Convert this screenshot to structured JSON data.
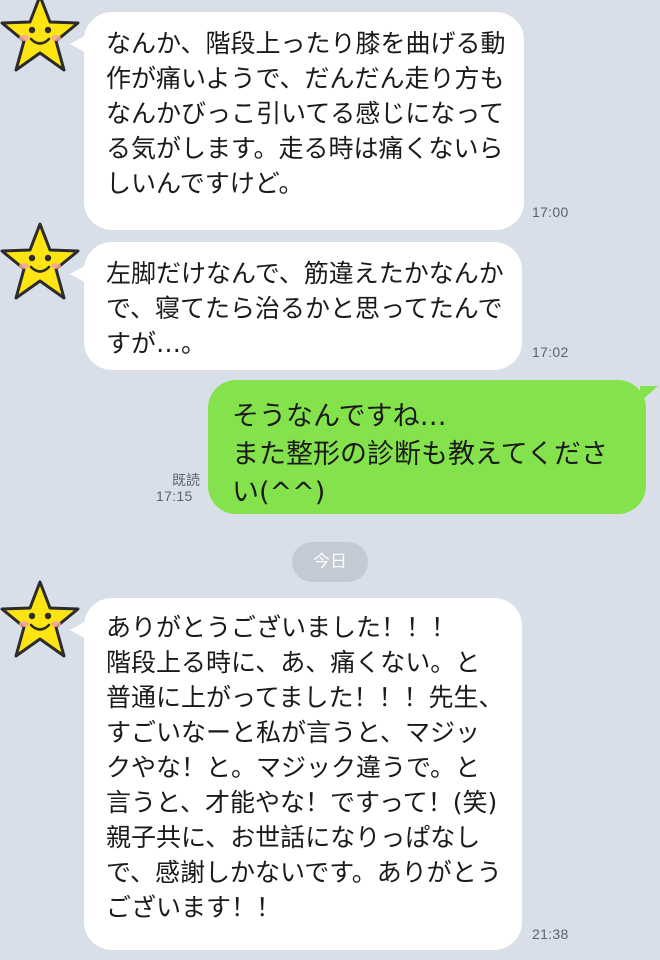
{
  "messages": [
    {
      "text": "なんか、階段上ったり膝を曲げる動作が痛いようで、だんだん走り方もなんかびっこ引いてる感じになってる気がします。走る時は痛くないらしいんですけど。",
      "time": "17:00",
      "avatar": "smiling-star-avatar"
    },
    {
      "text": "左脚だけなんで、筋違えたかなんかで、寝てたら治るかと思ってたんですが…。",
      "time": "17:02",
      "avatar": "smiling-star-avatar"
    },
    {
      "text": "そうなんですね…\nまた整形の診断も教えてください(^^)",
      "time": "17:15",
      "read_label": "既読"
    },
    {
      "text": "ありがとうございました！！！\n階段上る時に、あ、痛くない。と普通に上がってました！！！先生、すごいなーと私が言うと、マジックやな！と。マジック違うで。と言うと、才能やな！ですって！(笑)\n親子共に、お世話になりっぱなしで、感謝しかないです。ありがとうございます！！",
      "time": "21:38",
      "avatar": "smiling-star-avatar"
    }
  ],
  "date_separator": "今日",
  "colors": {
    "background": "#d9dfe8",
    "incoming_bubble": "#ffffff",
    "outgoing_bubble": "#84e34d",
    "star": "#ffe414"
  }
}
